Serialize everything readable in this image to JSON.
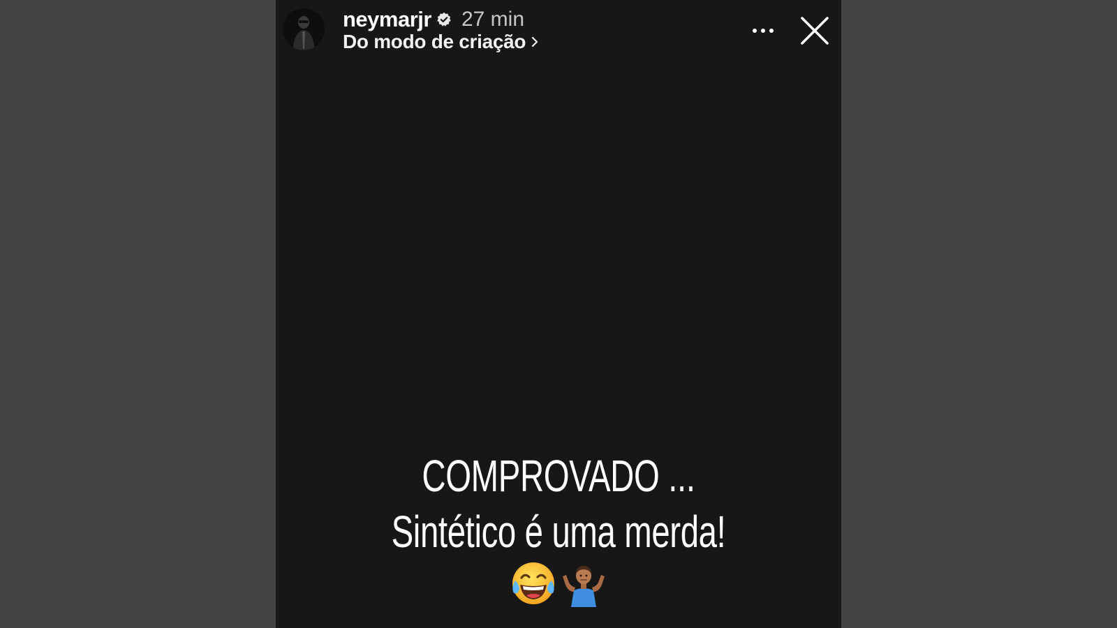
{
  "story": {
    "username": "neymarjr",
    "verified": true,
    "time_ago": "27 min",
    "source_label": "Do modo de criação",
    "more_icon": "more-horizontal-icon",
    "close_icon": "close-icon",
    "caption_lines": [
      "COMPROVADO ...",
      "Sintético é uma merda!"
    ],
    "emojis": [
      "face-with-tears-of-joy-emoji",
      "person-shrugging-emoji"
    ]
  },
  "colors": {
    "backdrop": "#444444",
    "story_background": "#171717",
    "text": "#ffffff",
    "time_text": "#c8c8c8"
  }
}
